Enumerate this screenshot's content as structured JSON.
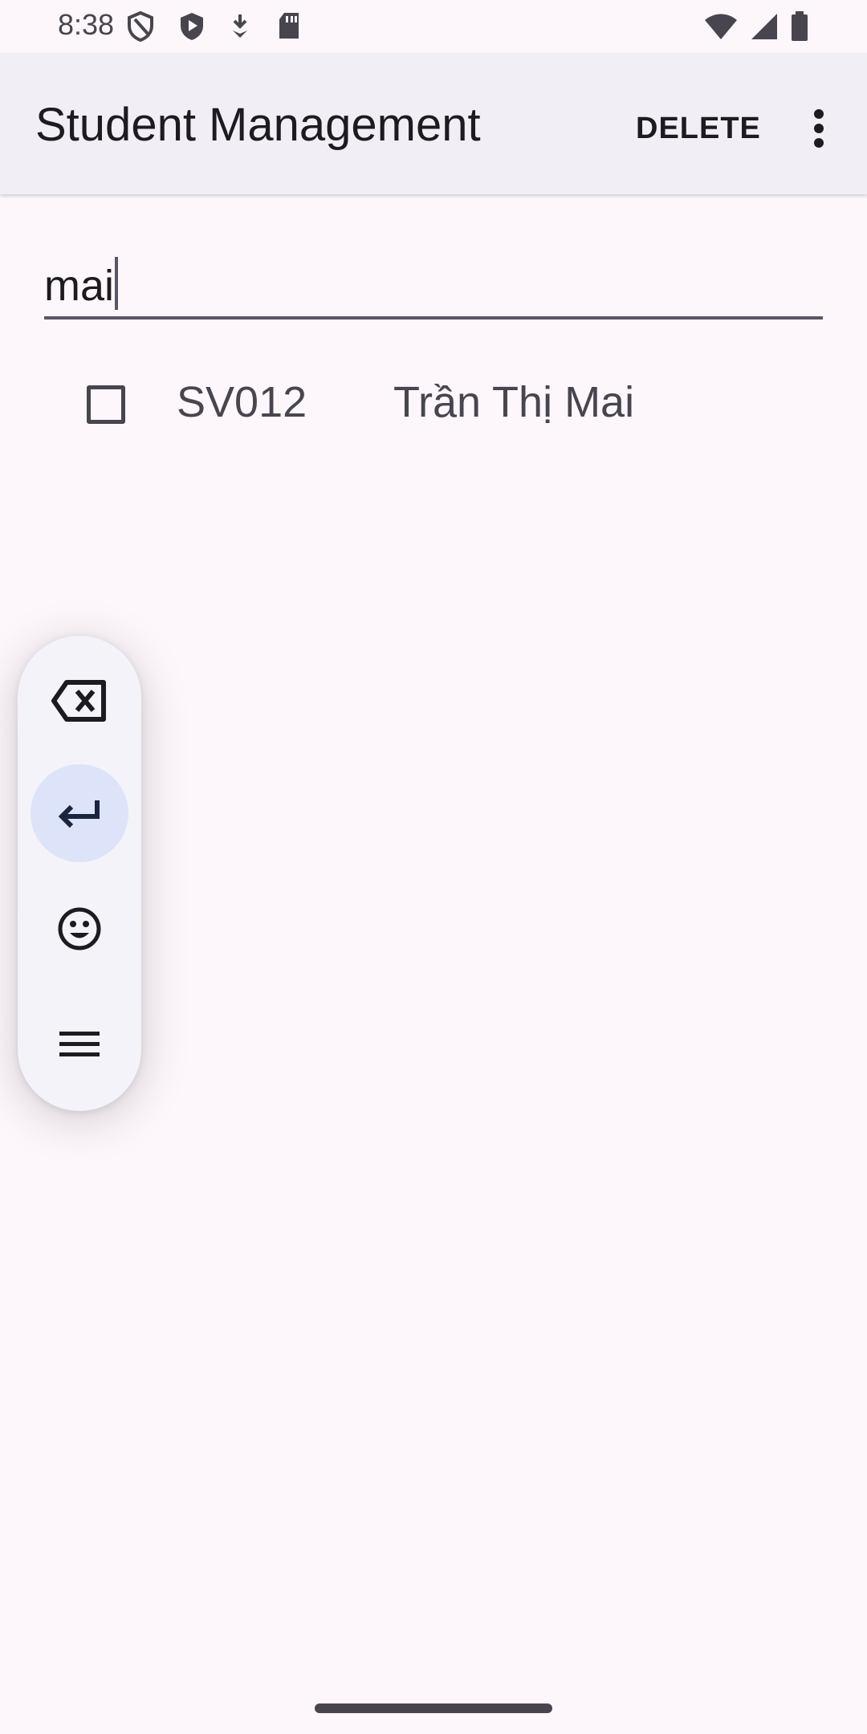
{
  "status_bar": {
    "time": "8:38",
    "icons_left": [
      "shield-outline-icon",
      "shield-play-icon",
      "download-arrow-icon",
      "sd-card-icon"
    ],
    "icons_right": [
      "wifi-icon",
      "signal-icon",
      "battery-icon"
    ]
  },
  "app_bar": {
    "title": "Student Management",
    "delete_label": "DELETE",
    "overflow_icon": "more-vert-icon"
  },
  "search": {
    "value": "mai"
  },
  "students": [
    {
      "id": "SV012",
      "name": "Trần Thị Mai",
      "checked": false
    }
  ],
  "keyboard_toolbar": {
    "buttons": [
      "backspace-icon",
      "enter-icon",
      "emoji-icon",
      "menu-icon"
    ],
    "active": "enter-icon"
  },
  "colors": {
    "background": "#fdf7fc",
    "app_bar": "#f2eef6",
    "text_primary": "#1d1b20",
    "text_secondary": "#49454f",
    "active_button": "#dde3f8"
  }
}
